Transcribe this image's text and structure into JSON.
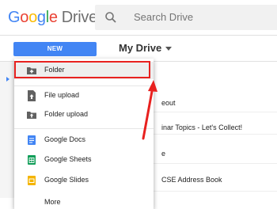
{
  "header": {
    "logo_word": "Google",
    "logo_product": "Drive",
    "search_placeholder": "Search Drive"
  },
  "toolbar": {
    "new_label": "NEW",
    "location_label": "My Drive"
  },
  "menu": {
    "items": [
      {
        "label": "Folder",
        "icon": "folder-add-icon"
      },
      {
        "label": "File upload",
        "icon": "file-upload-icon"
      },
      {
        "label": "Folder upload",
        "icon": "folder-upload-icon"
      },
      {
        "label": "Google Docs",
        "icon": "google-docs-icon"
      },
      {
        "label": "Google Sheets",
        "icon": "google-sheets-icon"
      },
      {
        "label": "Google Slides",
        "icon": "google-slides-icon"
      },
      {
        "label": "More",
        "icon": "more-icon"
      }
    ]
  },
  "files": [
    {
      "name": "eout"
    },
    {
      "name": "inar Topics - Let's Collect!"
    },
    {
      "name": "e"
    },
    {
      "name": "CSE Address Book"
    }
  ],
  "colors": {
    "accent": "#4285f4",
    "highlight": "#e8211f",
    "docs": "#4285f4",
    "sheets": "#0f9d58",
    "slides": "#f4b400"
  }
}
